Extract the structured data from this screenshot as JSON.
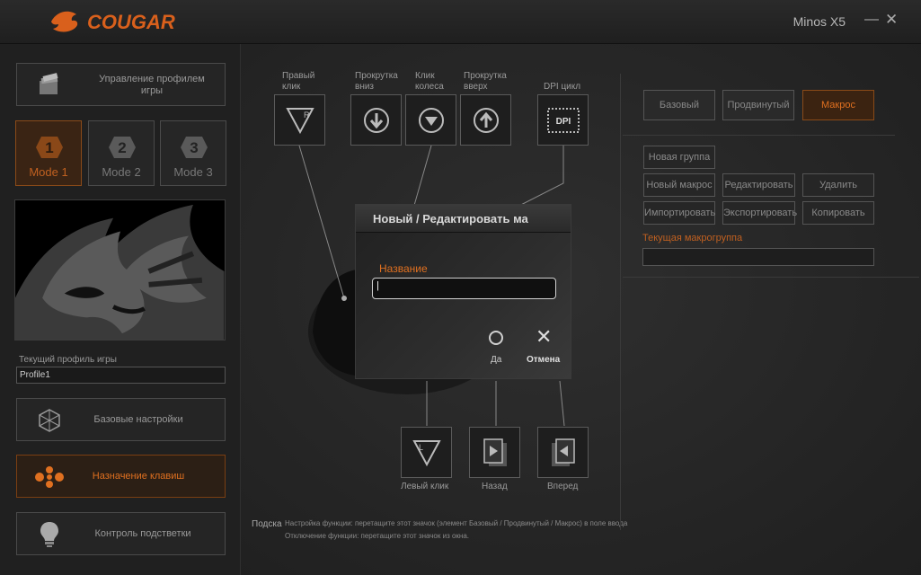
{
  "app": {
    "brand": "COUGAR",
    "model": "Minos X5",
    "minimize_label": "—",
    "close_label": "✕"
  },
  "sidebar": {
    "profile_mgmt_label": "Управление профилем\nигры",
    "modes": [
      {
        "num": "1",
        "label": "Mode 1",
        "active": true
      },
      {
        "num": "2",
        "label": "Mode 2",
        "active": false
      },
      {
        "num": "3",
        "label": "Mode 3",
        "active": false
      }
    ],
    "current_profile_label": "Текущий профиль игры",
    "current_profile_value": "Profile1",
    "nav": [
      {
        "label": "Базовые настройки",
        "icon": "cube-icon",
        "active": false
      },
      {
        "label": "Назначение клавиш",
        "icon": "buttons-icon",
        "active": true
      },
      {
        "label": "Контроль подстветки",
        "icon": "bulb-icon",
        "active": false
      }
    ]
  },
  "keymap": {
    "top_keys": [
      {
        "label": "Правый\nклик",
        "icon": "right-click-icon"
      },
      {
        "label": "Прокрутка\nвниз",
        "icon": "arrow-down-icon"
      },
      {
        "label": "Клик\nколеса",
        "icon": "wheel-click-icon"
      },
      {
        "label": "Прокрутка\nвверх",
        "icon": "arrow-up-icon"
      },
      {
        "label": "DPI цикл",
        "icon": "dpi-icon",
        "icon_text": "DPI"
      }
    ],
    "bottom_keys": [
      {
        "label": "Левый клик",
        "icon": "left-click-icon"
      },
      {
        "label": "Назад",
        "icon": "back-icon"
      },
      {
        "label": "Вперед",
        "icon": "forward-icon"
      }
    ],
    "right_click_glyph": "R",
    "left_click_glyph": "L",
    "hint_label": "Подска",
    "hint_line1": "Настройка функции: перетащите этот значок (элемент Базовый / Продвинутый / Макрос) в поле ввода",
    "hint_line2": "Отключение функции: перетащите этот значок из окна."
  },
  "right_panel": {
    "tabs": [
      {
        "label": "Базовый",
        "active": false
      },
      {
        "label": "Продвинутый",
        "active": false
      },
      {
        "label": "Макрос",
        "active": true
      }
    ],
    "new_group": "Новая группа",
    "macro_buttons": [
      "Новый макрос",
      "Редактировать",
      "Удалить",
      "Импортировать",
      "Экспортировать",
      "Копировать"
    ],
    "current_group_label": "Текущая макрогруппа",
    "current_group_value": ""
  },
  "dialog": {
    "title": "Новый / Редактировать ма",
    "name_label": "Название",
    "name_value": "|",
    "ok_label": "Да",
    "cancel_label": "Отмена",
    "cancel_glyph": "✕"
  },
  "colors": {
    "accent": "#e07020",
    "background": "#1e1e1e"
  }
}
